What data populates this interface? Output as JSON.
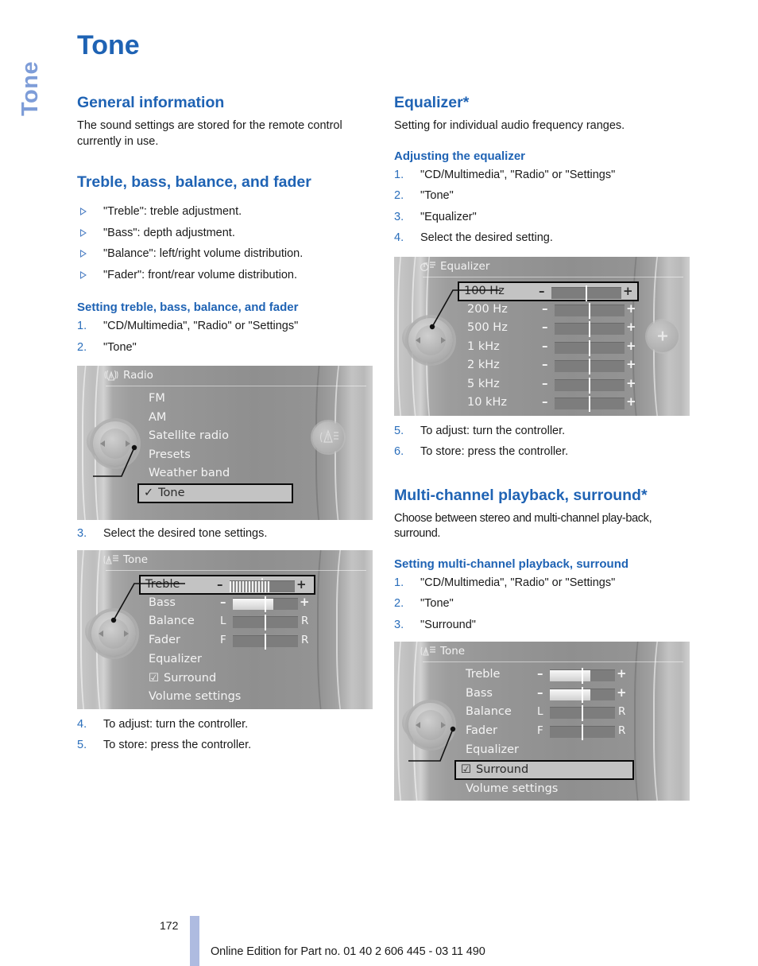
{
  "side_tab": {
    "label": "Tone"
  },
  "page": {
    "title": "Tone",
    "number": "172",
    "footer_note": "Online Edition for Part no. 01 40 2 606 445 - 03 11 490",
    "accent_blue": "#1f63b4",
    "accent_light_blue": "#7e9dd8",
    "footer_bar_color": "#aebbe0"
  },
  "left_column": {
    "general": {
      "heading": "General information",
      "paragraph": "The sound settings are stored for the remote control currently in use."
    },
    "treble_section": {
      "heading": "Treble, bass, balance, and fader",
      "bullets": [
        "\"Treble\": treble adjustment.",
        "\"Bass\": depth adjustment.",
        "\"Balance\": left/right volume distribution.",
        "\"Fader\": front/rear volume distribution."
      ],
      "subheading": "Setting treble, bass, balance, and fader",
      "steps_before": [
        {
          "num": "1.",
          "text": "\"CD/Multimedia\", \"Radio\" or \"Settings\""
        },
        {
          "num": "2.",
          "text": "\"Tone\""
        }
      ],
      "step_mid": {
        "num": "3.",
        "text": "Select the desired tone settings."
      },
      "steps_after": [
        {
          "num": "4.",
          "text": "To adjust: turn the controller."
        },
        {
          "num": "5.",
          "text": "To store: press the controller."
        }
      ]
    }
  },
  "right_column": {
    "equalizer_section": {
      "heading": "Equalizer*",
      "paragraph": "Setting for individual audio frequency ranges.",
      "subheading": "Adjusting the equalizer",
      "steps_before": [
        {
          "num": "1.",
          "text": "\"CD/Multimedia\", \"Radio\" or \"Settings\""
        },
        {
          "num": "2.",
          "text": "\"Tone\""
        },
        {
          "num": "3.",
          "text": "\"Equalizer\""
        },
        {
          "num": "4.",
          "text": "Select the desired setting."
        }
      ],
      "steps_after": [
        {
          "num": "5.",
          "text": "To adjust: turn the controller."
        },
        {
          "num": "6.",
          "text": "To store: press the controller."
        }
      ]
    },
    "surround_section": {
      "heading": "Multi-channel playback, surround*",
      "paragraph": "Choose between stereo and multi-channel play-back, surround.",
      "subheading": "Setting multi-channel playback, surround",
      "steps": [
        {
          "num": "1.",
          "text": "\"CD/Multimedia\", \"Radio\" or \"Settings\""
        },
        {
          "num": "2.",
          "text": "\"Tone\""
        },
        {
          "num": "3.",
          "text": "\"Surround\""
        }
      ]
    }
  },
  "screenshots": {
    "radio_menu": {
      "title": "Radio",
      "header_icon": "radio-waves-icon",
      "side_button_icon": "tone-speaker-icon",
      "items": [
        {
          "label": "FM",
          "highlighted": false,
          "check": ""
        },
        {
          "label": "AM",
          "highlighted": false,
          "check": ""
        },
        {
          "label": "Satellite radio",
          "highlighted": false,
          "check": ""
        },
        {
          "label": "Presets",
          "highlighted": false,
          "check": ""
        },
        {
          "label": "Weather band",
          "highlighted": false,
          "check": ""
        },
        {
          "label": "Tone",
          "highlighted": true,
          "check": "✓"
        }
      ]
    },
    "tone_menu": {
      "title": "Tone",
      "header_icon": "tone-speaker-icon",
      "rows": [
        {
          "type": "slider",
          "label": "Treble",
          "minus": "–",
          "plus": "+",
          "fill_pct": 62,
          "style": "stripes",
          "highlighted": true
        },
        {
          "type": "slider",
          "label": "Bass",
          "minus": "–",
          "plus": "+",
          "fill_pct": 62,
          "style": "solid",
          "highlighted": false
        },
        {
          "type": "lr",
          "label": "Balance",
          "left_mark": "L",
          "right_mark": "R",
          "fill_pct": 0,
          "highlighted": false
        },
        {
          "type": "lr",
          "label": "Fader",
          "left_mark": "F",
          "right_mark": "R",
          "fill_pct": 0,
          "highlighted": false
        },
        {
          "type": "text",
          "label": "Equalizer",
          "highlighted": false
        },
        {
          "type": "check",
          "label": "Surround",
          "check": "☑",
          "highlighted": false
        },
        {
          "type": "text",
          "label": "Volume settings",
          "highlighted": false
        }
      ]
    },
    "equalizer_menu": {
      "title": "Equalizer",
      "header_icon": "equalizer-note-icon",
      "side_button_icon": "plus-circle-icon",
      "side_button_glyph": "+",
      "bands": [
        {
          "label": "100 Hz",
          "minus": "–",
          "plus": "+",
          "highlighted": true
        },
        {
          "label": "200 Hz",
          "minus": "–",
          "plus": "+",
          "highlighted": false
        },
        {
          "label": "500 Hz",
          "minus": "–",
          "plus": "+",
          "highlighted": false
        },
        {
          "label": "1 kHz",
          "minus": "–",
          "plus": "+",
          "highlighted": false
        },
        {
          "label": "2 kHz",
          "minus": "–",
          "plus": "+",
          "highlighted": false
        },
        {
          "label": "5 kHz",
          "minus": "–",
          "plus": "+",
          "highlighted": false
        },
        {
          "label": "10 kHz",
          "minus": "–",
          "plus": "+",
          "highlighted": false
        }
      ]
    },
    "tone_surround_menu": {
      "title": "Tone",
      "header_icon": "tone-speaker-icon",
      "rows": [
        {
          "type": "slider",
          "label": "Treble",
          "minus": "–",
          "plus": "+",
          "fill_pct": 62,
          "style": "solid",
          "highlighted": false
        },
        {
          "type": "slider",
          "label": "Bass",
          "minus": "–",
          "plus": "+",
          "fill_pct": 62,
          "style": "solid",
          "highlighted": false
        },
        {
          "type": "lr",
          "label": "Balance",
          "left_mark": "L",
          "right_mark": "R",
          "highlighted": false
        },
        {
          "type": "lr",
          "label": "Fader",
          "left_mark": "F",
          "right_mark": "R",
          "highlighted": false
        },
        {
          "type": "text",
          "label": "Equalizer",
          "highlighted": false
        },
        {
          "type": "check",
          "label": "Surround",
          "check": "☑",
          "highlighted": true
        },
        {
          "type": "text",
          "label": "Volume settings",
          "highlighted": false
        }
      ]
    }
  }
}
